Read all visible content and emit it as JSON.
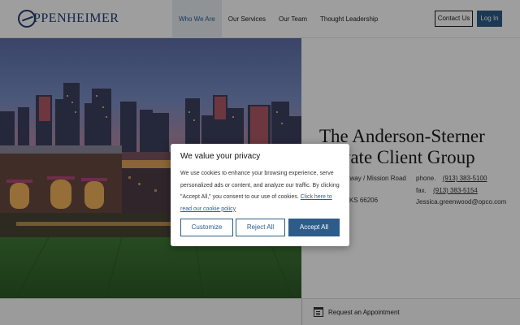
{
  "header": {
    "brand": "PPENHEIMER",
    "nav": [
      {
        "label": "Who We Are",
        "active": true
      },
      {
        "label": "Our Services",
        "active": false
      },
      {
        "label": "Our Team",
        "active": false
      },
      {
        "label": "Thought Leadership",
        "active": false
      }
    ],
    "contact_label": "Contact Us",
    "login_label": "Log In"
  },
  "info": {
    "title": "The Anderson-Sterner Private Client Group",
    "address_line1": "Ward Parkway / Mission Road",
    "address_line2": "Leawood, KS 66206",
    "phone_label": "phone.",
    "phone": "(913) 383-5100",
    "fax_label": "fax.",
    "fax": "(913) 383-5154",
    "email": "Jessica.greenwood@opco.com"
  },
  "footer": {
    "appointment_label": "Request an Appointment",
    "appointment_icon": "calendar-icon"
  },
  "cookie_modal": {
    "title": "We value your privacy",
    "body": "We use cookies to enhance your browsing experience, serve personalized ads or content, and analyze our traffic. By clicking \"Accept All,\" you consent to our use of cookies.",
    "link": "Click here to read our cookie policy",
    "customize_label": "Customize",
    "reject_label": "Reject All",
    "accept_label": "Accept All"
  },
  "colors": {
    "brand_navy": "#1f3e72",
    "accent_blue": "#2d5c8a",
    "overlay": "rgba(0,0,0,0.38)"
  }
}
